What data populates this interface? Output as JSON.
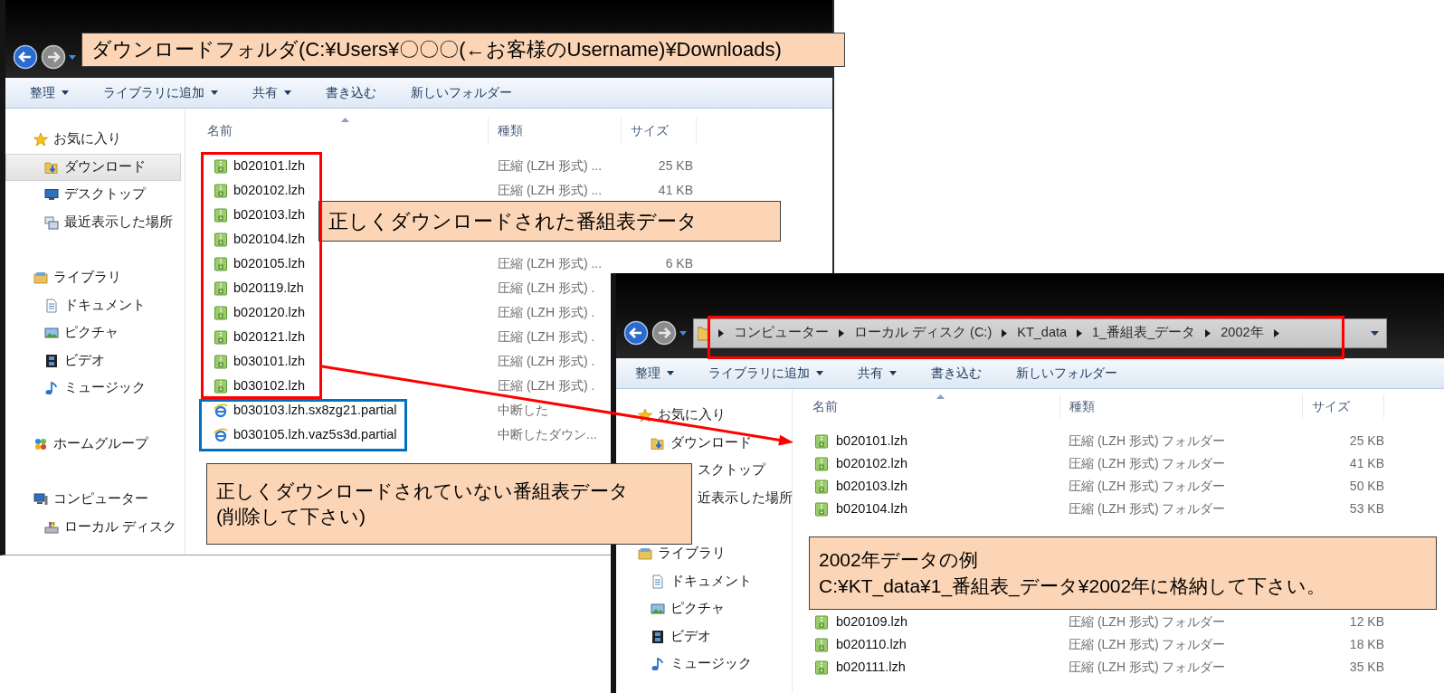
{
  "window_left": {
    "toolbar": [
      {
        "label": "整理",
        "dropdown": true
      },
      {
        "label": "ライブラリに追加",
        "dropdown": true
      },
      {
        "label": "共有",
        "dropdown": true
      },
      {
        "label": "書き込む",
        "dropdown": false
      },
      {
        "label": "新しいフォルダー",
        "dropdown": false
      }
    ],
    "sidebar": [
      {
        "label": "お気に入り",
        "kind": "star",
        "selected": false,
        "children": [
          {
            "label": "ダウンロード",
            "kind": "download",
            "selected": true
          },
          {
            "label": "デスクトップ",
            "kind": "desktop",
            "selected": false
          },
          {
            "label": "最近表示した場所",
            "kind": "recent",
            "selected": false
          }
        ]
      },
      {
        "label": "ライブラリ",
        "kind": "library",
        "selected": false,
        "children": [
          {
            "label": "ドキュメント",
            "kind": "document",
            "selected": false
          },
          {
            "label": "ピクチャ",
            "kind": "picture",
            "selected": false
          },
          {
            "label": "ビデオ",
            "kind": "video",
            "selected": false
          },
          {
            "label": "ミュージック",
            "kind": "music",
            "selected": false
          }
        ]
      },
      {
        "label": "ホームグループ",
        "kind": "homegroup",
        "selected": false
      },
      {
        "label": "コンピューター",
        "kind": "computer",
        "selected": false,
        "children": [
          {
            "label": "ローカル ディスク",
            "kind": "disk",
            "selected": false
          }
        ]
      }
    ],
    "columns": [
      "名前",
      "種類",
      "サイズ"
    ],
    "files": [
      {
        "name": "b020101.lzh",
        "kind": "lzh",
        "type": "圧縮 (LZH 形式) ...",
        "size": "25 KB"
      },
      {
        "name": "b020102.lzh",
        "kind": "lzh",
        "type": "圧縮 (LZH 形式) ...",
        "size": "41 KB"
      },
      {
        "name": "b020103.lzh",
        "kind": "lzh"
      },
      {
        "name": "b020104.lzh",
        "kind": "lzh"
      },
      {
        "name": "b020105.lzh",
        "kind": "lzh",
        "type": "圧縮 (LZH 形式) ...",
        "size": "6 KB"
      },
      {
        "name": "b020119.lzh",
        "kind": "lzh",
        "type": "圧縮 (LZH 形式) ."
      },
      {
        "name": "b020120.lzh",
        "kind": "lzh",
        "type": "圧縮 (LZH 形式) ."
      },
      {
        "name": "b020121.lzh",
        "kind": "lzh",
        "type": "圧縮 (LZH 形式) ."
      },
      {
        "name": "b030101.lzh",
        "kind": "lzh",
        "type": "圧縮 (LZH 形式) ."
      },
      {
        "name": "b030102.lzh",
        "kind": "lzh",
        "type": "圧縮 (LZH 形式) ."
      },
      {
        "name": "b030103.lzh.sx8zg21.partial",
        "kind": "partial",
        "type": "中断した"
      },
      {
        "name": "b030105.lzh.vaz5s3d.partial",
        "kind": "partial",
        "type": "中断したダウン..."
      }
    ]
  },
  "window_right": {
    "address": [
      "コンピューター",
      "ローカル ディスク (C:)",
      "KT_data",
      "1_番組表_データ",
      "2002年"
    ],
    "toolbar": [
      {
        "label": "整理",
        "dropdown": true
      },
      {
        "label": "ライブラリに追加",
        "dropdown": true
      },
      {
        "label": "共有",
        "dropdown": true
      },
      {
        "label": "書き込む",
        "dropdown": false
      },
      {
        "label": "新しいフォルダー",
        "dropdown": false
      }
    ],
    "sidebar": [
      {
        "label": "お気に入り",
        "kind": "star",
        "selected": false,
        "children": [
          {
            "label": "ダウンロード",
            "kind": "download",
            "selected": false
          },
          {
            "label": "スクトップ",
            "kind": "covered",
            "selected": false
          },
          {
            "label": "近表示した場所",
            "kind": "covered",
            "selected": false
          }
        ]
      },
      {
        "label": "ライブラリ",
        "kind": "library",
        "selected": false,
        "children": [
          {
            "label": "ドキュメント",
            "kind": "document",
            "selected": false
          },
          {
            "label": "ピクチャ",
            "kind": "picture",
            "selected": false
          },
          {
            "label": "ビデオ",
            "kind": "video",
            "selected": false
          },
          {
            "label": "ミュージック",
            "kind": "music",
            "selected": false
          }
        ]
      }
    ],
    "columns": [
      "名前",
      "種類",
      "サイズ"
    ],
    "files": [
      {
        "name": "b020101.lzh",
        "kind": "lzh",
        "type": "圧縮 (LZH 形式) フォルダー",
        "size": "25 KB"
      },
      {
        "name": "b020102.lzh",
        "kind": "lzh",
        "type": "圧縮 (LZH 形式) フォルダー",
        "size": "41 KB"
      },
      {
        "name": "b020103.lzh",
        "kind": "lzh",
        "type": "圧縮 (LZH 形式) フォルダー",
        "size": "50 KB"
      },
      {
        "name": "b020104.lzh",
        "kind": "lzh",
        "type": "圧縮 (LZH 形式) フォルダー",
        "size": "53 KB"
      }
    ],
    "files_below_note": [
      {
        "name": "b020109.lzh",
        "kind": "lzh",
        "type": "圧縮 (LZH 形式) フォルダー",
        "size": "12 KB"
      },
      {
        "name": "b020110.lzh",
        "kind": "lzh",
        "type": "圧縮 (LZH 形式) フォルダー",
        "size": "18 KB"
      },
      {
        "name": "b020111.lzh",
        "kind": "lzh",
        "type": "圧縮 (LZH 形式) フォルダー",
        "size": "35 KB"
      }
    ]
  },
  "callouts": [
    {
      "lines": [
        "ダウンロードフォルダ(C:¥Users¥〇〇〇(←お客様のUsername)¥Downloads)"
      ]
    },
    {
      "lines": [
        "正しくダウンロードされた番組表データ"
      ]
    },
    {
      "lines": [
        "正しくダウンロードされていない番組表データ",
        "(削除して下さい)"
      ]
    },
    {
      "lines": [
        "2002年データの例",
        "C:¥KT_data¥1_番組表_データ¥2002年に格納して下さい。"
      ]
    }
  ],
  "frames": [
    {
      "color": "#ff0000"
    },
    {
      "color": "#0070c0"
    },
    {
      "color": "#ff0000"
    }
  ]
}
